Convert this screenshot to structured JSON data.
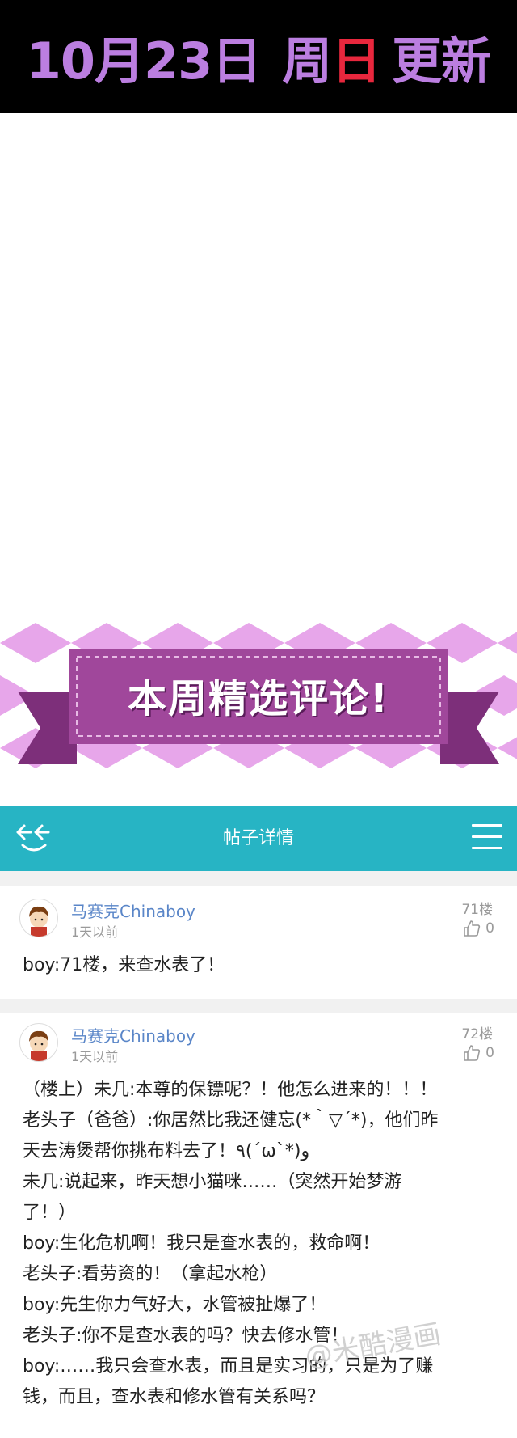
{
  "banner": {
    "date": "10月23日",
    "week_prefix": "周",
    "week_day": "日",
    "update": "更新"
  },
  "section": {
    "title": "本周精选评论!"
  },
  "appbar": {
    "title": "帖子详情"
  },
  "posts": [
    {
      "user": "马赛克Chinaboy",
      "time": "1天以前",
      "floor": "71楼",
      "likes": "0",
      "lines": [
        "boy:71楼，来查水表了！"
      ]
    },
    {
      "user": "马赛克Chinaboy",
      "time": "1天以前",
      "floor": "72楼",
      "likes": "0",
      "lines": [
        "（楼上）未几:本尊的保镖呢？！他怎么进来的！！！",
        "老头子（爸爸）:你居然比我还健忘(*｀▽´*)，他们昨",
        "天去涛煲帮你挑布料去了！٩(´ω`*)ﻭ",
        "未几:说起来，昨天想小猫咪……（突然开始梦游",
        "了！）",
        "boy:生化危机啊！我只是查水表的，救命啊！",
        "老头子:看劳资的！（拿起水枪）",
        "boy:先生你力气好大，水管被扯爆了！",
        "老头子:你不是查水表的吗？快去修水管！",
        "boy:……我只会查水表，而且是实习的，只是为了赚",
        "钱，而且，查水表和修水管有关系吗？"
      ]
    }
  ],
  "watermark": "@米酷漫画",
  "colors": {
    "banner_bg": "#000000",
    "banner_text": "#bb7ee0",
    "banner_highlight": "#e8273d",
    "appbar_bg": "#27b4c4",
    "ribbon": "#a0479b",
    "diamond": "#e7a6ea",
    "username": "#5a86c8"
  },
  "icons": [
    "back-smile-icon",
    "menu-icon",
    "thumbs-up-icon",
    "avatar-icon"
  ]
}
